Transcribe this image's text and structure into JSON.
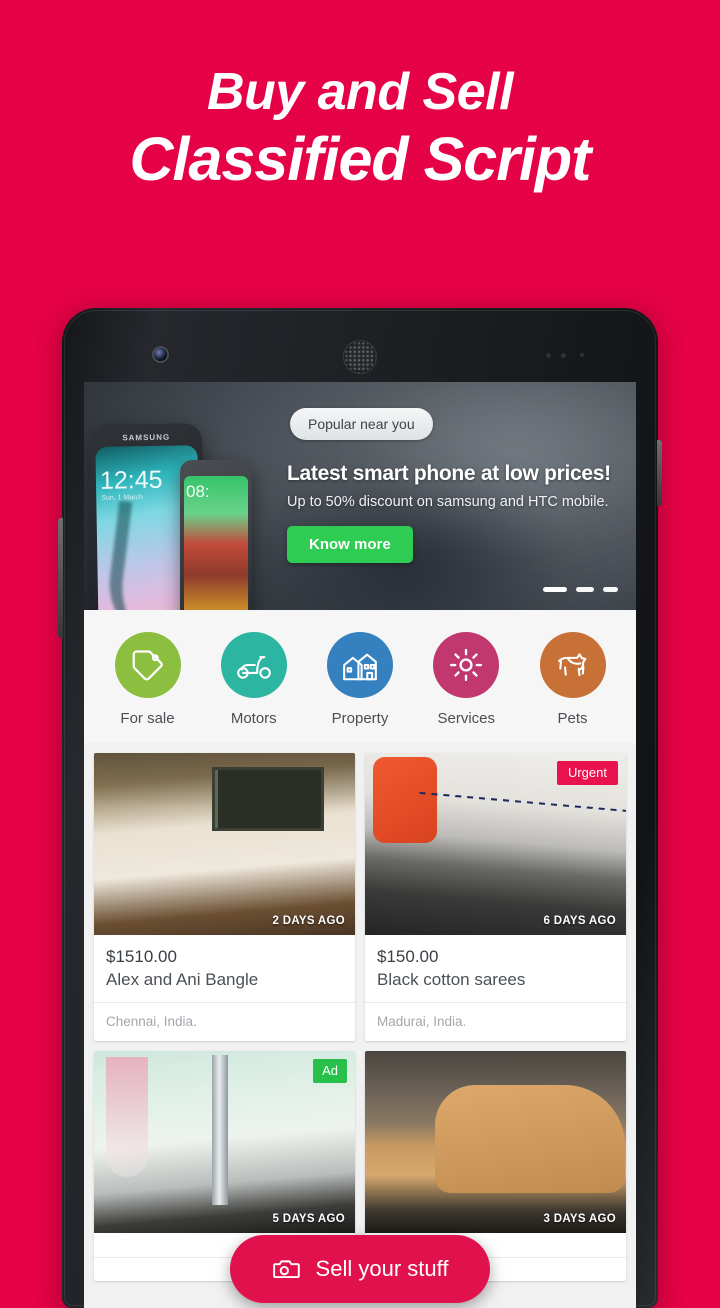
{
  "promo": {
    "line1": "Buy and Sell",
    "line2": "Classified Script",
    "background_color": "#E50246"
  },
  "device": {
    "name": "android-phone-mockup",
    "front_camera": "front-camera",
    "earpiece": "earpiece-speaker",
    "power_button": "power-button",
    "volume_button": "volume-button"
  },
  "hero": {
    "pill_label": "Popular near you",
    "title": "Latest smart phone at low prices!",
    "subtitle": "Up to 50% discount on samsung and HTC mobile.",
    "cta_label": "Know more",
    "cta_color": "#2ecc53",
    "phone_art_1": {
      "brand": "SAMSUNG",
      "clock": "12:45",
      "date": "Sun, 1 March"
    },
    "phone_art_2": {
      "clock": "08:"
    },
    "carousel": {
      "total": 3,
      "active": 1
    }
  },
  "categories": [
    {
      "label": "For sale",
      "icon": "price-tag-icon",
      "color": "#8CBF3F"
    },
    {
      "label": "Motors",
      "icon": "scooter-icon",
      "color": "#2CB5A0"
    },
    {
      "label": "Property",
      "icon": "house-icon",
      "color": "#3580BE"
    },
    {
      "label": "Services",
      "icon": "gear-icon",
      "color": "#C0386E"
    },
    {
      "label": "Pets",
      "icon": "dog-icon",
      "color": "#C87137"
    }
  ],
  "listings": [
    {
      "price": "$1510.00",
      "title": "Alex and Ani Bangle",
      "location": "Chennai, India.",
      "time_ago": "2 DAYS AGO",
      "badge": null,
      "image": "bedroom-furniture-photo"
    },
    {
      "price": "$150.00",
      "title": "Black cotton sarees",
      "location": "Madurai, India.",
      "time_ago": "6 DAYS AGO",
      "badge": {
        "label": "Urgent",
        "color": "#E8134E"
      },
      "image": "white-fabric-roll-photo"
    },
    {
      "price": "",
      "title": "",
      "location": "",
      "time_ago": "5 DAYS AGO",
      "badge": {
        "label": "Ad",
        "color": "#27C04B"
      },
      "image": "glassware-photo"
    },
    {
      "price": "",
      "title": "",
      "location": "",
      "time_ago": "3 DAYS AGO",
      "badge": null,
      "image": "suede-boots-photo"
    }
  ],
  "fab": {
    "label": "Sell your stuff",
    "icon": "camera-icon",
    "color": "#E0114C"
  }
}
